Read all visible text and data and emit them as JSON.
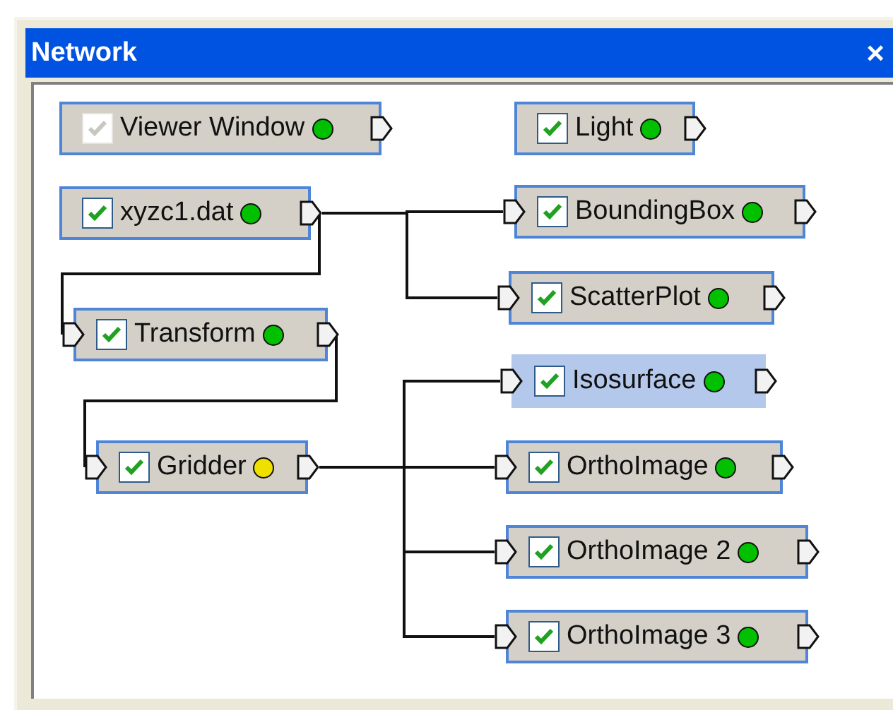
{
  "window": {
    "title": "Network",
    "close": "×"
  },
  "nodes": [
    {
      "label": "Viewer Window",
      "checked": true,
      "disabled": true,
      "selected": false,
      "inputs": false,
      "color": "#00c000"
    },
    {
      "label": "Light",
      "checked": true,
      "disabled": false,
      "selected": false,
      "inputs": false,
      "color": "#00c000"
    },
    {
      "label": "xyzc1.dat",
      "checked": true,
      "disabled": false,
      "selected": false,
      "inputs": false,
      "color": "#00c000"
    },
    {
      "label": "BoundingBox",
      "checked": true,
      "disabled": false,
      "selected": false,
      "inputs": true,
      "color": "#00c000"
    },
    {
      "label": "ScatterPlot",
      "checked": true,
      "disabled": false,
      "selected": false,
      "inputs": true,
      "color": "#00c000"
    },
    {
      "label": "Transform",
      "checked": true,
      "disabled": false,
      "selected": false,
      "inputs": true,
      "color": "#00c000"
    },
    {
      "label": "Isosurface",
      "checked": true,
      "disabled": false,
      "selected": true,
      "inputs": true,
      "color": "#00c000"
    },
    {
      "label": "Gridder",
      "checked": true,
      "disabled": false,
      "selected": false,
      "inputs": true,
      "color": "#f0e000"
    },
    {
      "label": "OrthoImage",
      "checked": true,
      "disabled": false,
      "selected": false,
      "inputs": true,
      "color": "#00c000"
    },
    {
      "label": "OrthoImage 2",
      "checked": true,
      "disabled": false,
      "selected": false,
      "inputs": true,
      "color": "#00c000"
    },
    {
      "label": "OrthoImage 3",
      "checked": true,
      "disabled": false,
      "selected": false,
      "inputs": true,
      "color": "#00c000"
    }
  ]
}
